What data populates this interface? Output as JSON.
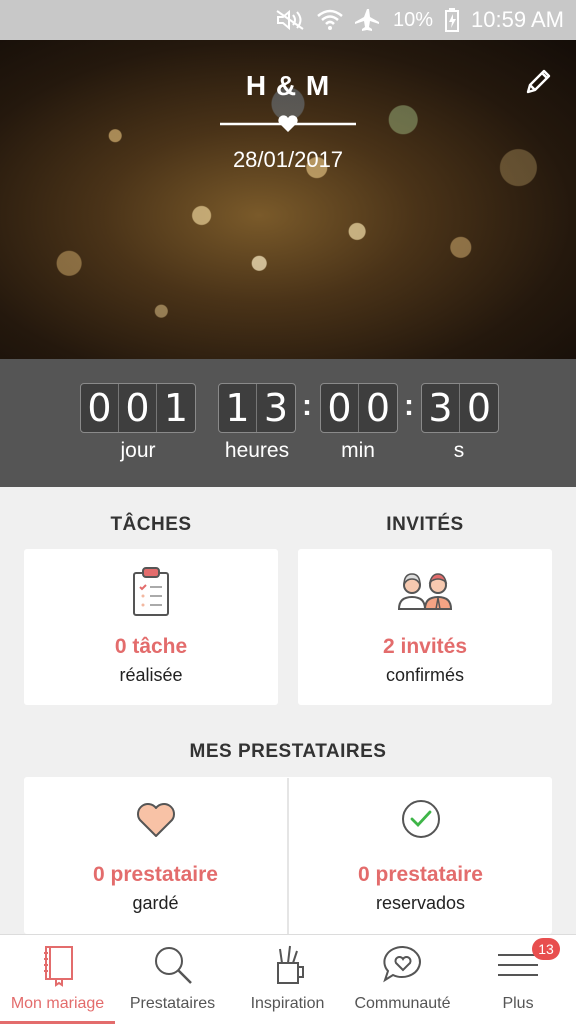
{
  "status_bar": {
    "battery": "10%",
    "time": "10:59 AM",
    "icons": [
      "mute-icon",
      "wifi-icon",
      "airplane-icon",
      "charging-icon"
    ]
  },
  "header": {
    "couple": "H & M",
    "date": "28/01/2017",
    "edit_icon": "pencil-icon"
  },
  "countdown": {
    "days": [
      "0",
      "0",
      "1"
    ],
    "hours": [
      "1",
      "3"
    ],
    "minutes": [
      "0",
      "0"
    ],
    "seconds": [
      "3",
      "0"
    ],
    "separator": ":",
    "labels": {
      "days": "jour",
      "hours": "heures",
      "minutes": "min",
      "seconds": "s"
    }
  },
  "tasks": {
    "title": "TÂCHES",
    "value": "0 tâche",
    "sub": "réalisée",
    "icon": "clipboard-icon"
  },
  "guests": {
    "title": "INVITÉS",
    "value": "2 invités",
    "sub": "confirmés",
    "icon": "couple-icon"
  },
  "vendors": {
    "title": "MES PRESTATAIRES",
    "kept": {
      "value": "0 prestataire",
      "sub": "gardé",
      "icon": "heart-icon"
    },
    "booked": {
      "value": "0 prestataire",
      "sub": "reservados",
      "icon": "check-circle-icon"
    }
  },
  "nav": {
    "items": [
      {
        "label": "Mon mariage",
        "icon": "notebook-icon",
        "active": true
      },
      {
        "label": "Prestataires",
        "icon": "search-icon",
        "active": false
      },
      {
        "label": "Inspiration",
        "icon": "pencil-cup-icon",
        "active": false
      },
      {
        "label": "Communauté",
        "icon": "chat-heart-icon",
        "active": false
      },
      {
        "label": "Plus",
        "icon": "menu-icon",
        "active": false
      }
    ],
    "badge": "13"
  },
  "colors": {
    "accent": "#e36c6c",
    "countdown_bg": "#555555",
    "status_bar_bg": "#c8c8c8"
  }
}
